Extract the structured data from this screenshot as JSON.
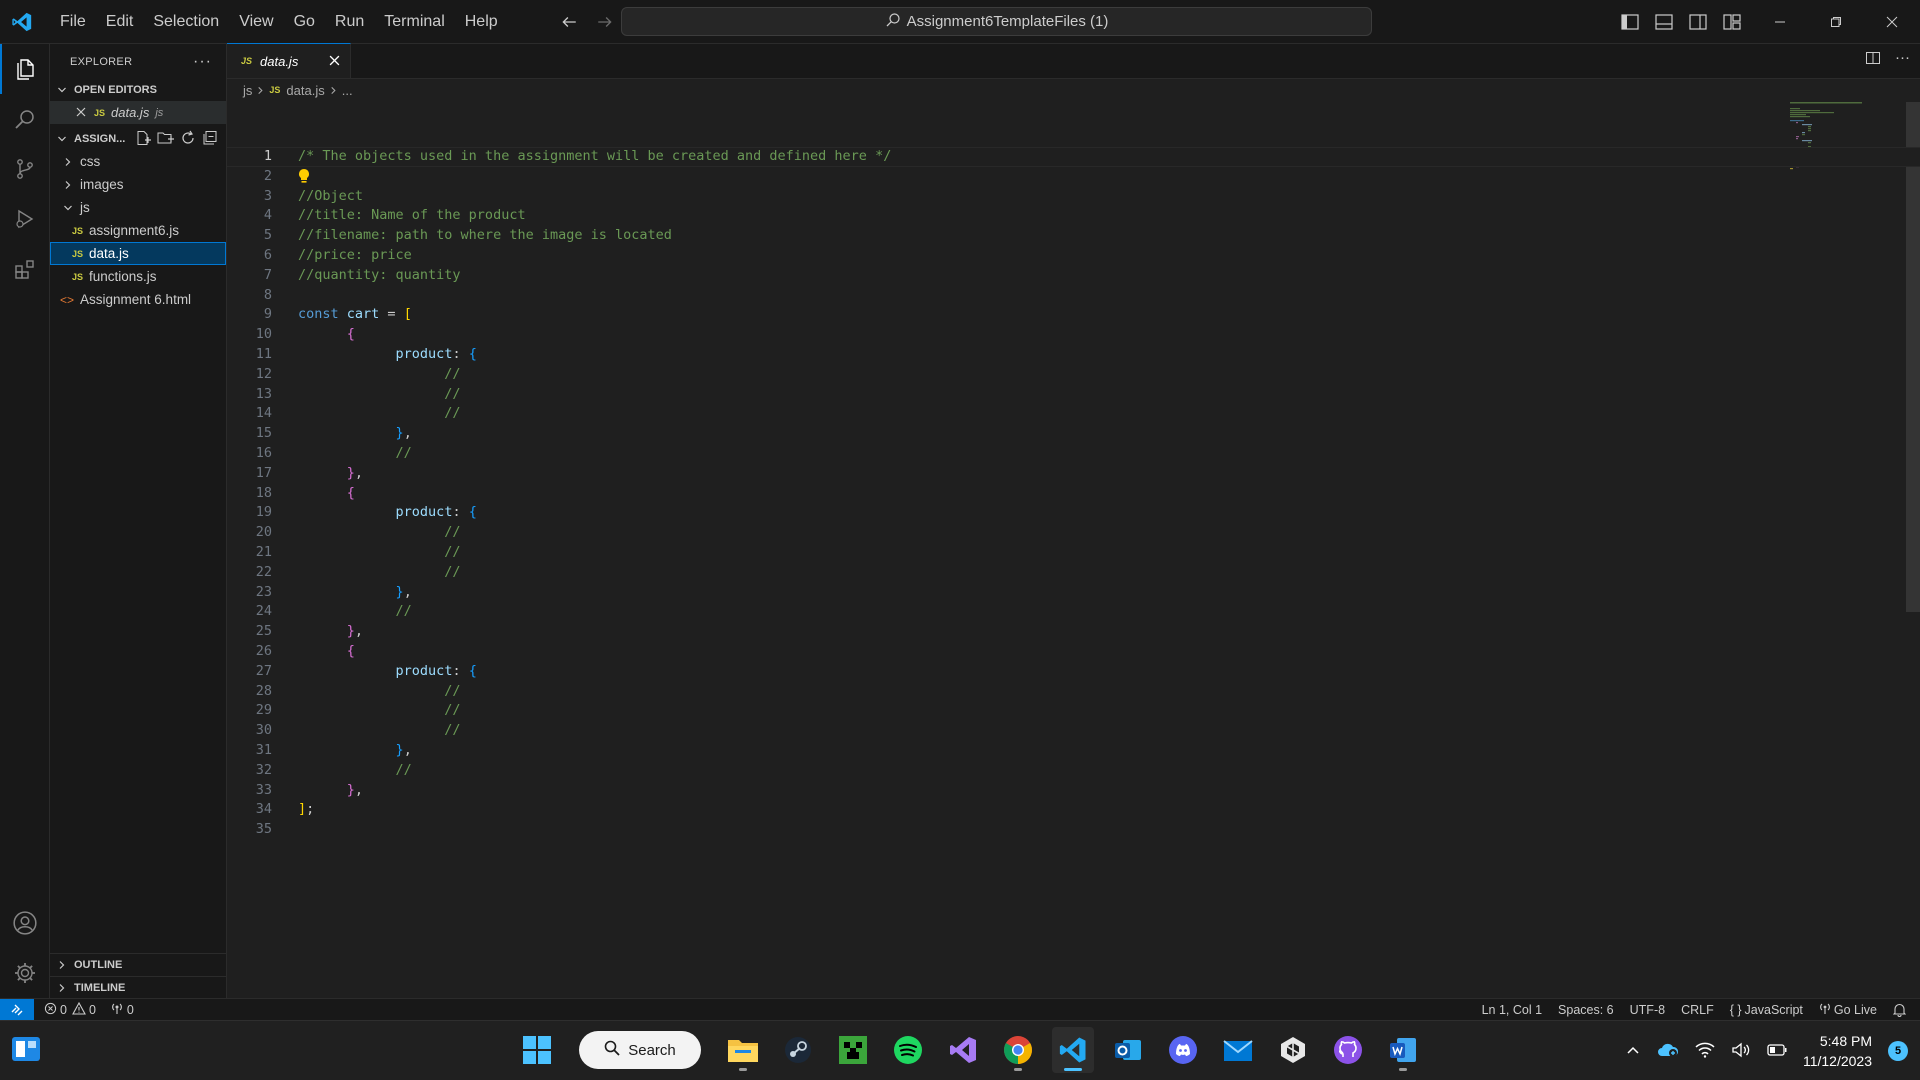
{
  "titlebar": {
    "menu": [
      "File",
      "Edit",
      "Selection",
      "View",
      "Go",
      "Run",
      "Terminal",
      "Help"
    ],
    "command_center": "Assignment6TemplateFiles (1)"
  },
  "sidebar": {
    "title": "EXPLORER",
    "open_editors_label": "OPEN EDITORS",
    "open_editor": {
      "name": "data.js",
      "hint": "js"
    },
    "workspace_label": "ASSIGN...",
    "tree": [
      {
        "name": "css",
        "type": "folder",
        "depth": 0
      },
      {
        "name": "images",
        "type": "folder",
        "depth": 0
      },
      {
        "name": "js",
        "type": "folder-open",
        "depth": 0
      },
      {
        "name": "assignment6.js",
        "type": "js",
        "depth": 1
      },
      {
        "name": "data.js",
        "type": "js",
        "depth": 1,
        "selected": true
      },
      {
        "name": "functions.js",
        "type": "js",
        "depth": 1
      },
      {
        "name": "Assignment 6.html",
        "type": "html",
        "depth": 0
      }
    ],
    "outline_label": "OUTLINE",
    "timeline_label": "TIMELINE"
  },
  "editor": {
    "tab_label": "data.js",
    "breadcrumb": [
      "js",
      "data.js",
      "..."
    ],
    "lines": [
      [
        {
          "t": "/* The objects used in the assignment will be created and defined here */",
          "c": "c-comment"
        }
      ],
      [
        {
          "t": "💡",
          "c": "bulb"
        }
      ],
      [
        {
          "t": "//Object",
          "c": "c-comment"
        }
      ],
      [
        {
          "t": "//title: Name of the product",
          "c": "c-comment"
        }
      ],
      [
        {
          "t": "//filename: path to where the image is located",
          "c": "c-comment"
        }
      ],
      [
        {
          "t": "//price: price",
          "c": "c-comment"
        }
      ],
      [
        {
          "t": "//quantity: quantity",
          "c": "c-comment"
        }
      ],
      [],
      [
        {
          "t": "const ",
          "c": "c-kw"
        },
        {
          "t": "cart",
          "c": "c-var"
        },
        {
          "t": " = ",
          "c": ""
        },
        {
          "t": "[",
          "c": "c-brk1"
        }
      ],
      [
        {
          "t": "      ",
          "c": ""
        },
        {
          "t": "{",
          "c": "c-brk2"
        }
      ],
      [
        {
          "t": "            ",
          "c": ""
        },
        {
          "t": "product",
          "c": "c-prop"
        },
        {
          "t": ": ",
          "c": ""
        },
        {
          "t": "{",
          "c": "c-brk3"
        }
      ],
      [
        {
          "t": "                  //",
          "c": "c-comment"
        }
      ],
      [
        {
          "t": "                  //",
          "c": "c-comment"
        }
      ],
      [
        {
          "t": "                  //",
          "c": "c-comment"
        }
      ],
      [
        {
          "t": "            ",
          "c": ""
        },
        {
          "t": "}",
          "c": "c-brk3"
        },
        {
          "t": ",",
          "c": ""
        }
      ],
      [
        {
          "t": "            //",
          "c": "c-comment"
        }
      ],
      [
        {
          "t": "      ",
          "c": ""
        },
        {
          "t": "}",
          "c": "c-brk2"
        },
        {
          "t": ",",
          "c": ""
        }
      ],
      [
        {
          "t": "      ",
          "c": ""
        },
        {
          "t": "{",
          "c": "c-brk2"
        }
      ],
      [
        {
          "t": "            ",
          "c": ""
        },
        {
          "t": "product",
          "c": "c-prop"
        },
        {
          "t": ": ",
          "c": ""
        },
        {
          "t": "{",
          "c": "c-brk3"
        }
      ],
      [
        {
          "t": "                  //",
          "c": "c-comment"
        }
      ],
      [
        {
          "t": "                  //",
          "c": "c-comment"
        }
      ],
      [
        {
          "t": "                  //",
          "c": "c-comment"
        }
      ],
      [
        {
          "t": "            ",
          "c": ""
        },
        {
          "t": "}",
          "c": "c-brk3"
        },
        {
          "t": ",",
          "c": ""
        }
      ],
      [
        {
          "t": "            //",
          "c": "c-comment"
        }
      ],
      [
        {
          "t": "      ",
          "c": ""
        },
        {
          "t": "}",
          "c": "c-brk2"
        },
        {
          "t": ",",
          "c": ""
        }
      ],
      [
        {
          "t": "      ",
          "c": ""
        },
        {
          "t": "{",
          "c": "c-brk2"
        }
      ],
      [
        {
          "t": "            ",
          "c": ""
        },
        {
          "t": "product",
          "c": "c-prop"
        },
        {
          "t": ": ",
          "c": ""
        },
        {
          "t": "{",
          "c": "c-brk3"
        }
      ],
      [
        {
          "t": "                  //",
          "c": "c-comment"
        }
      ],
      [
        {
          "t": "                  //",
          "c": "c-comment"
        }
      ],
      [
        {
          "t": "                  //",
          "c": "c-comment"
        }
      ],
      [
        {
          "t": "            ",
          "c": ""
        },
        {
          "t": "}",
          "c": "c-brk3"
        },
        {
          "t": ",",
          "c": ""
        }
      ],
      [
        {
          "t": "            //",
          "c": "c-comment"
        }
      ],
      [
        {
          "t": "      ",
          "c": ""
        },
        {
          "t": "}",
          "c": "c-brk2"
        },
        {
          "t": ",",
          "c": ""
        }
      ],
      [
        {
          "t": "]",
          "c": "c-brk1"
        },
        {
          "t": ";",
          "c": ""
        }
      ],
      []
    ]
  },
  "statusbar": {
    "errors": "0",
    "warnings": "0",
    "ports": "0",
    "cursor": "Ln 1, Col 1",
    "spaces": "Spaces: 6",
    "encoding": "UTF-8",
    "eol": "CRLF",
    "language": "JavaScript",
    "golive": "Go Live"
  },
  "taskbar": {
    "search_label": "Search",
    "time": "5:48 PM",
    "date": "11/12/2023",
    "notifications": "5"
  },
  "colors": {
    "accent": "#0078d4",
    "comment": "#6a9955",
    "keyword": "#569cd6"
  }
}
